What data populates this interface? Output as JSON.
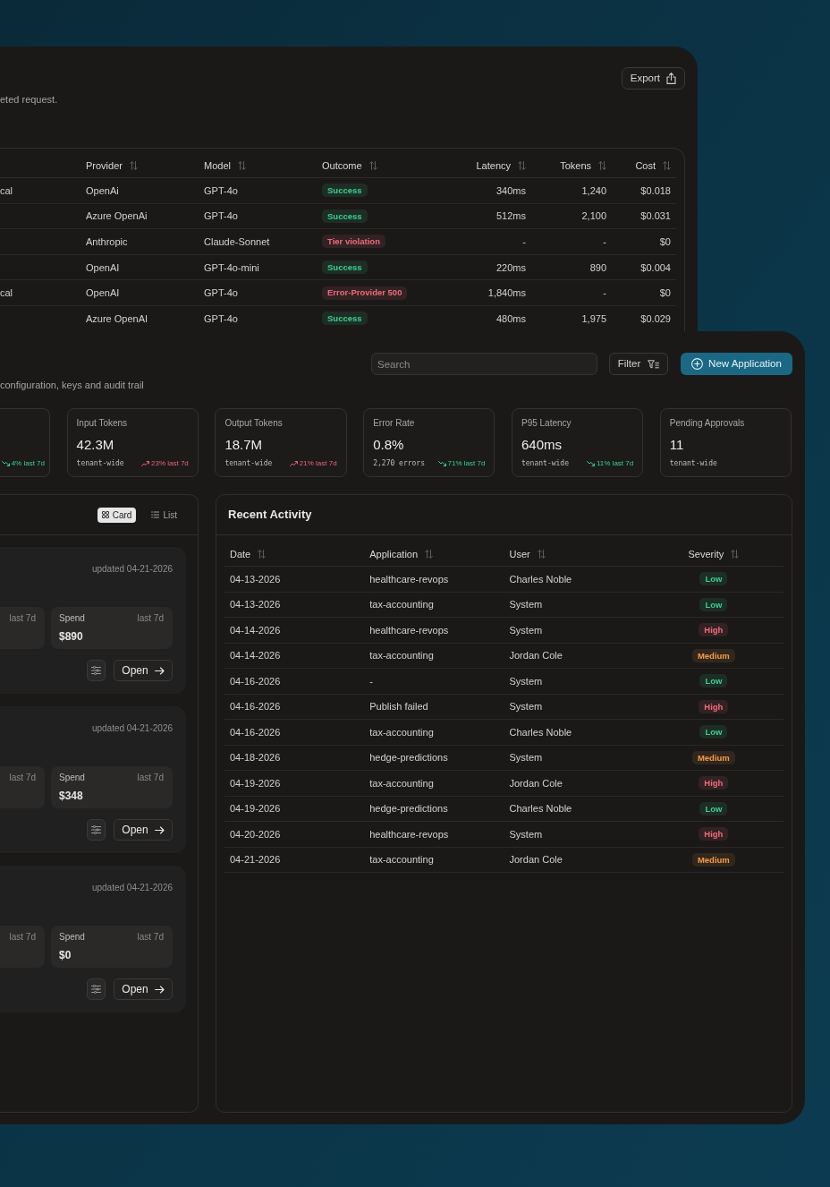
{
  "requests_panel": {
    "subtitle": "eted request.",
    "export_button": {
      "label": "Export"
    },
    "table": {
      "columns": [
        {
          "label": "Provider"
        },
        {
          "label": "Model"
        },
        {
          "label": "Outcome"
        },
        {
          "label": "Latency"
        },
        {
          "label": "Tokens"
        },
        {
          "label": "Cost"
        }
      ],
      "rows": [
        {
          "column_1": "cal",
          "provider": "OpenAi",
          "model": "GPT-4o",
          "outcome": {
            "label": "Success",
            "color": "#3ccf8e"
          },
          "latency": "340ms",
          "tokens": "1,240",
          "cost": "$0.018"
        },
        {
          "provider": "Azure OpenAi",
          "model": "GPT-4o",
          "outcome": {
            "label": "Success",
            "color": "#3ccf8e"
          },
          "latency": "512ms",
          "tokens": "2,100",
          "cost": "$0.031"
        },
        {
          "provider": "Anthropic",
          "model": "Claude-Sonnet",
          "outcome": {
            "label": "Tier violation",
            "color": "#f06a7c"
          },
          "latency": "-",
          "tokens": "-",
          "cost": "$0"
        },
        {
          "provider": "OpenAI",
          "model": "GPT-4o-mini",
          "outcome": {
            "label": "Success",
            "color": "#3ccf8e"
          },
          "latency": "220ms",
          "tokens": "890",
          "cost": "$0.004"
        },
        {
          "column_1": "cal",
          "provider": "OpenAI",
          "model": "GPT-4o",
          "outcome": {
            "label": "Error-Provider 500",
            "color": "#f06a7c"
          },
          "latency": "1,840ms",
          "tokens": "-",
          "cost": "$0"
        },
        {
          "provider": "Azure OpenAI",
          "model": "GPT-4o",
          "outcome": {
            "label": "Success",
            "color": "#3ccf8e"
          },
          "latency": "480ms",
          "tokens": "1,975",
          "cost": "$0.029"
        }
      ]
    }
  },
  "applications_panel": {
    "search": {
      "placeholder": "Search"
    },
    "filter_button": {
      "label": "Filter"
    },
    "new_button": {
      "label": "New Application"
    },
    "subtitle": "configuration, keys and audit trail",
    "stats": [
      {
        "trend": {
          "text": "4% last 7d",
          "rising": false
        }
      },
      {
        "label": "Input Tokens",
        "value": "42.3M",
        "note": "tenant-wide",
        "trend": {
          "text": "23% last 7d",
          "rising": true
        }
      },
      {
        "label": "Output Tokens",
        "value": "18.7M",
        "note": "tenant-wide",
        "trend": {
          "text": "21% last 7d",
          "rising": true
        }
      },
      {
        "label": "Error Rate",
        "value": "0.8%",
        "note": "2,270 errors",
        "trend": {
          "text": "71% last 7d",
          "rising": false
        }
      },
      {
        "label": "P95 Latency",
        "value": "640ms",
        "note": "tenant-wide",
        "trend": {
          "text": "11% last 7d",
          "rising": false
        }
      },
      {
        "label": "Pending Approvals",
        "value": "11",
        "note": "tenant-wide"
      }
    ],
    "view_toggle": [
      {
        "label": "Card",
        "selected": true
      },
      {
        "label": "List",
        "selected": false
      }
    ],
    "cards": [
      {
        "updated": "updated 04-21-2026",
        "metrics": [
          {
            "period": "last 7d"
          },
          {
            "label": "Spend",
            "period": "last 7d",
            "value": "$890"
          }
        ],
        "open_button": {
          "label": "Open"
        }
      },
      {
        "updated": "updated 04-21-2026",
        "metrics": [
          {
            "period": "last 7d"
          },
          {
            "label": "Spend",
            "period": "last 7d",
            "value": "$348"
          }
        ],
        "open_button": {
          "label": "Open"
        }
      },
      {
        "updated": "updated 04-21-2026",
        "metrics": [
          {
            "period": "last 7d"
          },
          {
            "label": "Spend",
            "period": "last 7d",
            "value": "$0"
          }
        ],
        "open_button": {
          "label": "Open"
        }
      }
    ],
    "recent_activity": {
      "title": "Recent Activity",
      "columns": [
        {
          "label": "Date"
        },
        {
          "label": "Application"
        },
        {
          "label": "User"
        },
        {
          "label": "Severity"
        }
      ],
      "rows": [
        {
          "date": "04-13-2026",
          "application": "healthcare-revops",
          "user": "Charles Noble",
          "severity": {
            "label": "Low",
            "color": "#3ccf8e"
          }
        },
        {
          "date": "04-13-2026",
          "application": "tax-accounting",
          "user": "System",
          "severity": {
            "label": "Low",
            "color": "#3ccf8e"
          }
        },
        {
          "date": "04-14-2026",
          "application": "healthcare-revops",
          "user": "System",
          "severity": {
            "label": "High",
            "color": "#f06a7c"
          }
        },
        {
          "date": "04-14-2026",
          "application": "tax-accounting",
          "user": "Jordan Cole",
          "severity": {
            "label": "Medium",
            "color": "#f59b47"
          }
        },
        {
          "date": "04-16-2026",
          "application": "-",
          "user": "System",
          "severity": {
            "label": "Low",
            "color": "#3ccf8e"
          }
        },
        {
          "date": "04-16-2026",
          "application": "Publish failed",
          "user": "System",
          "severity": {
            "label": "High",
            "color": "#f06a7c"
          }
        },
        {
          "date": "04-16-2026",
          "application": "tax-accounting",
          "user": "Charles Noble",
          "severity": {
            "label": "Low",
            "color": "#3ccf8e"
          }
        },
        {
          "date": "04-18-2026",
          "application": "hedge-predictions",
          "user": "System",
          "severity": {
            "label": "Medium",
            "color": "#f59b47"
          }
        },
        {
          "date": "04-19-2026",
          "application": "tax-accounting",
          "user": "Jordan Cole",
          "severity": {
            "label": "High",
            "color": "#f06a7c"
          }
        },
        {
          "date": "04-19-2026",
          "application": "hedge-predictions",
          "user": "Charles Noble",
          "severity": {
            "label": "Low",
            "color": "#3ccf8e"
          }
        },
        {
          "date": "04-20-2026",
          "application": "healthcare-revops",
          "user": "System",
          "severity": {
            "label": "High",
            "color": "#f06a7c"
          }
        },
        {
          "date": "04-21-2026",
          "application": "tax-accounting",
          "user": "Jordan Cole",
          "severity": {
            "label": "Medium",
            "color": "#f59b47"
          }
        }
      ]
    }
  }
}
